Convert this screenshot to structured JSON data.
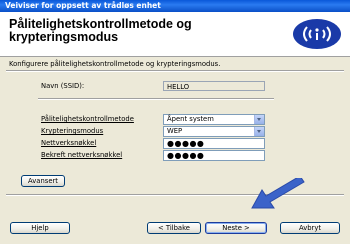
{
  "window": {
    "title": "Veiviser for oppsett av trådløs enhet"
  },
  "header": {
    "title": "Pålitelighetskontrollmetode og krypteringsmodus"
  },
  "instruction": "Konfigurere pålitelighetskontrollmetode og krypteringsmodus.",
  "ssid": {
    "label": "Navn (SSID):",
    "value": "HELLO"
  },
  "auth_method": {
    "label": "Pålitelighetskontrollmetode",
    "value": "Åpent system"
  },
  "encryption": {
    "label": "Krypteringsmodus",
    "value": "WEP"
  },
  "network_key": {
    "label": "Nettverksnøkkel",
    "value": "●●●●●"
  },
  "confirm_key": {
    "label": "Bekreft nettverksnøkkel",
    "value": "●●●●●"
  },
  "buttons": {
    "advanced": "Avansert",
    "help": "Hjelp",
    "back": "< Tilbake",
    "next": "Neste >",
    "cancel": "Avbryt"
  },
  "colors": {
    "titlebar": "#0a58d8",
    "logo": "#1a3aa8",
    "arrow": "#3b63c9"
  }
}
